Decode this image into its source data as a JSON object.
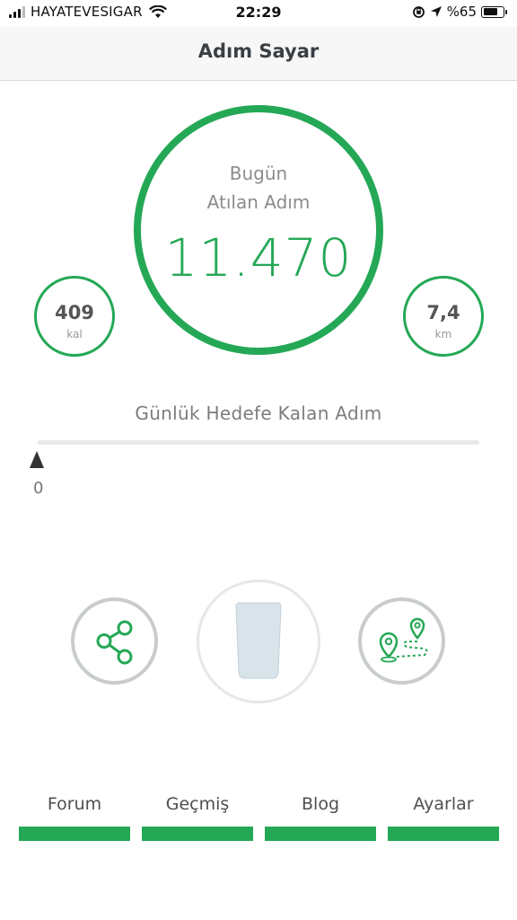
{
  "status_bar": {
    "carrier": "HAYATEVESIGAR",
    "time": "22:29",
    "battery_percent": "%65",
    "battery_level": 0.65
  },
  "header": {
    "title": "Adım Sayar"
  },
  "steps": {
    "label_line1": "Bugün",
    "label_line2": "Atılan Adım",
    "value": "11.470"
  },
  "calories": {
    "value": "409",
    "unit": "kal"
  },
  "distance": {
    "value": "7,4",
    "unit": "km"
  },
  "goal": {
    "label": "Günlük Hedefe Kalan Adım",
    "remaining_value": "0",
    "progress": 0
  },
  "actions": [
    {
      "name": "share",
      "icon": "share-icon"
    },
    {
      "name": "water",
      "icon": "water-glass-icon"
    },
    {
      "name": "route",
      "icon": "route-map-icon"
    }
  ],
  "tabs": [
    {
      "label": "Forum"
    },
    {
      "label": "Geçmiş"
    },
    {
      "label": "Blog"
    },
    {
      "label": "Ayarlar"
    }
  ],
  "colors": {
    "accent": "#24a855",
    "ring_gray": "#c9cccd",
    "text_gray": "#8c8c8c"
  }
}
